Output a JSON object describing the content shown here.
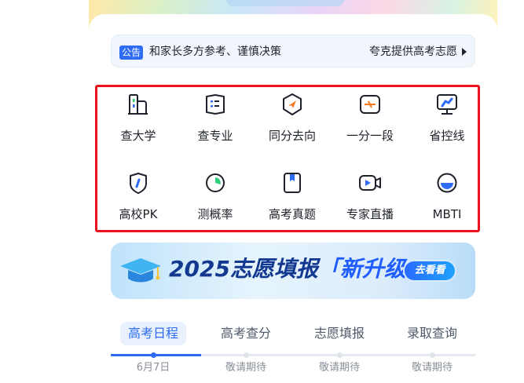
{
  "notice": {
    "tag": "公告",
    "text": "和家长多方参考、谨慎决策",
    "more": "夸克提供高考志愿"
  },
  "tools": [
    {
      "label": "查大学",
      "icon": "university-icon"
    },
    {
      "label": "查专业",
      "icon": "major-icon"
    },
    {
      "label": "同分去向",
      "icon": "compass-icon"
    },
    {
      "label": "一分一段",
      "icon": "score-segment-icon"
    },
    {
      "label": "省控线",
      "icon": "control-line-icon"
    },
    {
      "label": "高校PK",
      "icon": "shield-icon"
    },
    {
      "label": "测概率",
      "icon": "probability-pie-icon"
    },
    {
      "label": "高考真题",
      "icon": "exam-book-icon"
    },
    {
      "label": "专家直播",
      "icon": "live-video-icon"
    },
    {
      "label": "MBTI",
      "icon": "mbti-icon"
    }
  ],
  "banner": {
    "title_main": "2025志愿填报",
    "title_accent": "「新升级」",
    "go_label": "去看看"
  },
  "tabs": [
    {
      "label": "高考日程",
      "date": "6月7日",
      "active": true
    },
    {
      "label": "高考查分",
      "date": "敬请期待",
      "active": false
    },
    {
      "label": "志愿填报",
      "date": "敬请期待",
      "active": false
    },
    {
      "label": "录取查询",
      "date": "敬请期待",
      "active": false
    }
  ],
  "colors": {
    "accent": "#2b6af3",
    "highlight_border": "#e8131f",
    "icon_blue": "#2f6cf6",
    "icon_orange": "#f47a1f",
    "icon_green": "#2fcf7a"
  }
}
